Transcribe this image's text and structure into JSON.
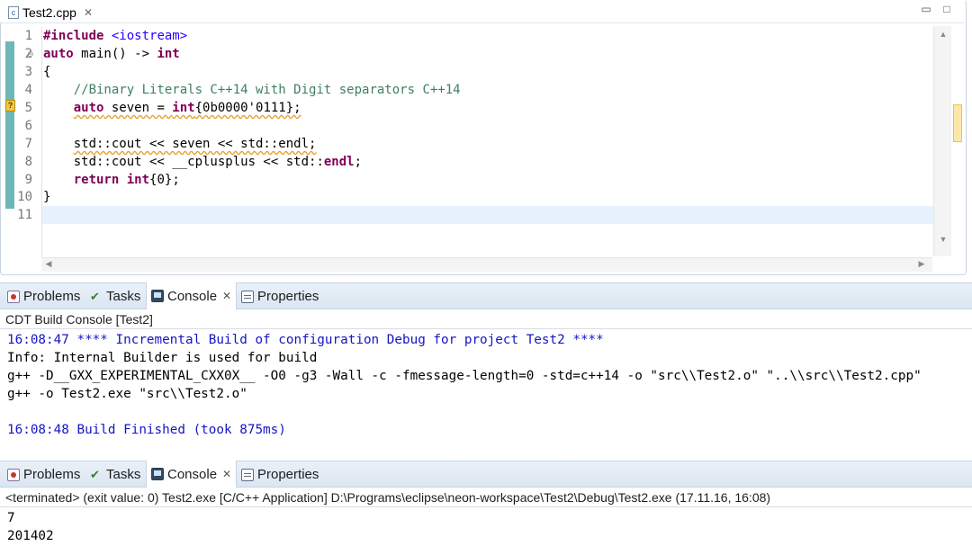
{
  "editor": {
    "tab_label": "Test2.cpp",
    "file_icon_name": "cpp-file-icon",
    "warning_marker": "?",
    "line_numbers": [
      "1",
      "2",
      "3",
      "4",
      "5",
      "6",
      "7",
      "8",
      "9",
      "10",
      "11"
    ],
    "code": {
      "l1_kw": "#include",
      "l1_inc": "<iostream>",
      "l2_kw1": "auto",
      "l2_txt": " main() -> ",
      "l2_kw2": "int",
      "l3": "{",
      "l4_comment": "//Binary Literals C++14 with Digit separators C++14",
      "l5_kw1": "auto",
      "l5_txt1": " seven = ",
      "l5_kw2": "int",
      "l5_txt2": "{0b0000'0111};",
      "l7": "std::cout << seven << std::endl;",
      "l8_txt": "std::cout << __cplusplus << std::",
      "l8_kw": "endl",
      "l8_end": ";",
      "l9_kw1": "return",
      "l9_sp": " ",
      "l9_kw2": "int",
      "l9_txt": "{0};",
      "l10": "}"
    }
  },
  "build_panel": {
    "tabs": [
      "Problems",
      "Tasks",
      "Console",
      "Properties"
    ],
    "active_tab": "Console",
    "header": "CDT Build Console [Test2]",
    "lines": [
      "16:08:47 **** Incremental Build of configuration Debug for project Test2 ****",
      "Info: Internal Builder is used for build",
      "g++ -D__GXX_EXPERIMENTAL_CXX0X__ -O0 -g3 -Wall -c -fmessage-length=0 -std=c++14 -o \"src\\\\Test2.o\" \"..\\\\src\\\\Test2.cpp\"",
      "g++ -o Test2.exe \"src\\\\Test2.o\"",
      "16:08:48 Build Finished (took 875ms)"
    ]
  },
  "run_panel": {
    "tabs": [
      "Problems",
      "Tasks",
      "Console",
      "Properties"
    ],
    "active_tab": "Console",
    "header": "<terminated> (exit value: 0) Test2.exe [C/C++ Application] D:\\Programs\\eclipse\\neon-workspace\\Test2\\Debug\\Test2.exe (17.11.16, 16:08)",
    "lines": [
      "7",
      "201402"
    ]
  },
  "colors": {
    "keyword": "#7f0055",
    "comment": "#3f7f5f",
    "include": "#2a00ff",
    "console_blue": "#1414c8"
  }
}
